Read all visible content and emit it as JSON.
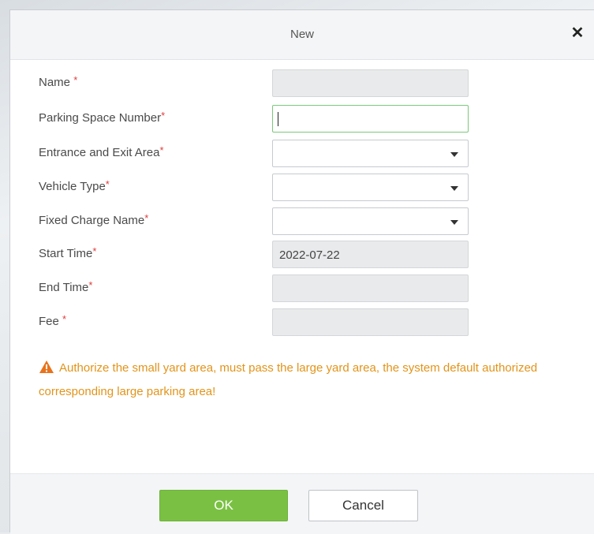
{
  "dialog": {
    "title": "New",
    "close_symbol": "✕",
    "required_marker": "*"
  },
  "fields": [
    {
      "label": "Name",
      "value": "",
      "type": "readonly-text"
    },
    {
      "label": "Parking Space Number",
      "value": "",
      "type": "text-focused"
    },
    {
      "label": "Entrance and Exit Area",
      "value": "",
      "type": "select"
    },
    {
      "label": "Vehicle Type",
      "value": "",
      "type": "select"
    },
    {
      "label": "Fixed Charge Name",
      "value": "",
      "type": "select"
    },
    {
      "label": "Start Time",
      "value": "2022-07-22",
      "type": "readonly-text"
    },
    {
      "label": "End Time",
      "value": "",
      "type": "readonly-text"
    },
    {
      "label": "Fee",
      "value": "",
      "type": "readonly-text"
    }
  ],
  "warning": {
    "icon": "warning-triangle-icon",
    "text": "Authorize the small yard area, must pass the large yard area, the system default authorized corresponding large parking area!",
    "color": "#e2941a"
  },
  "buttons": {
    "ok_label": "OK",
    "cancel_label": "Cancel"
  },
  "colors": {
    "primary_button": "#7ac143",
    "required_asterisk": "#e23c3c",
    "focus_border": "#7cc77c"
  }
}
